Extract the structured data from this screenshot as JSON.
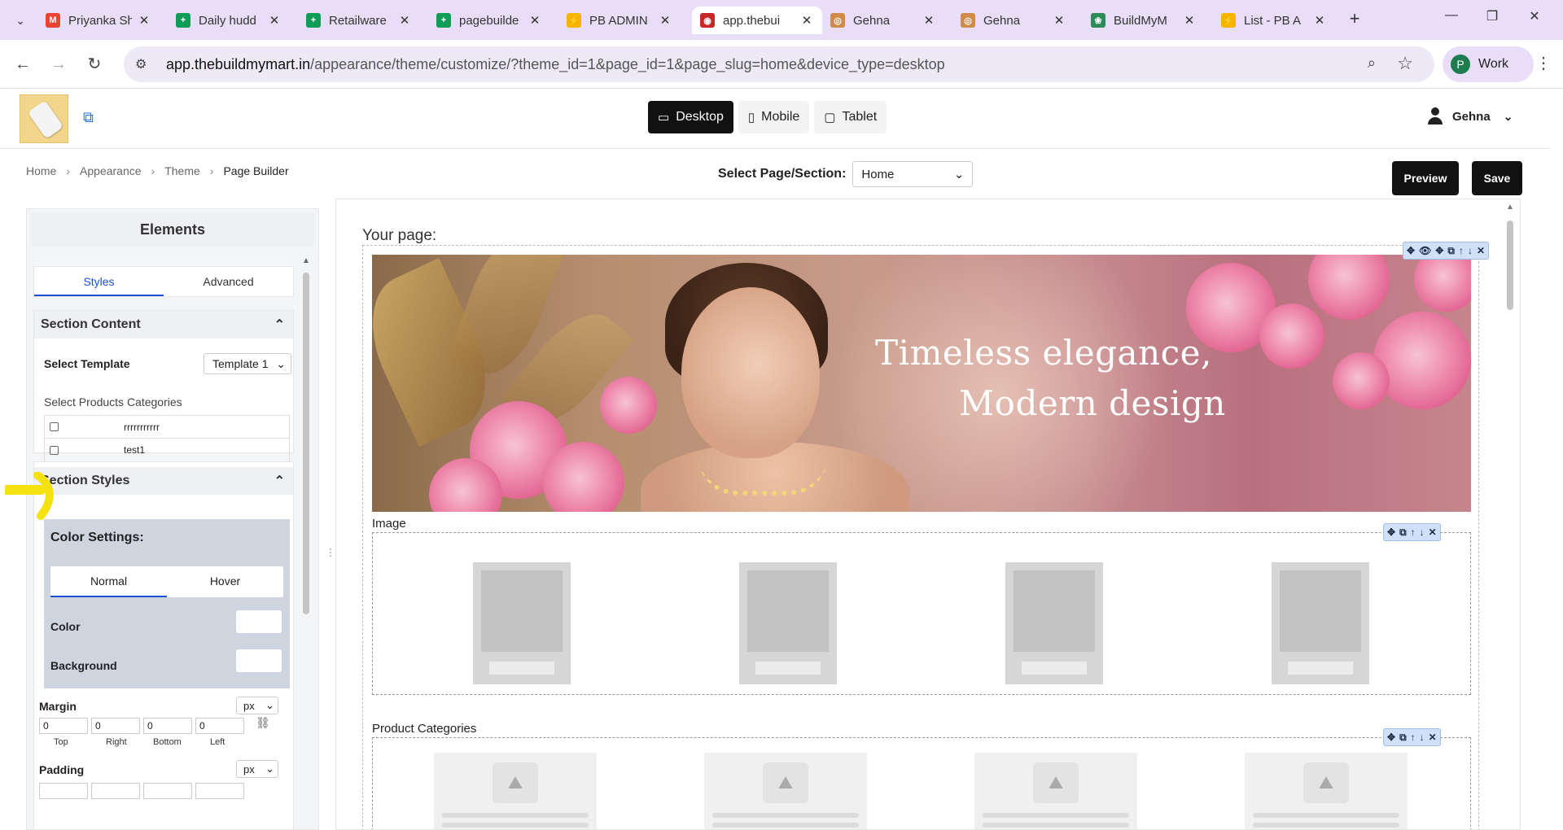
{
  "browser": {
    "tabs": [
      {
        "title": "Priyanka Sh",
        "fav": "M",
        "color": "#ea4335"
      },
      {
        "title": "Daily hudd",
        "fav": "+",
        "color": "#0f9d58"
      },
      {
        "title": "Retailware",
        "fav": "+",
        "color": "#0f9d58"
      },
      {
        "title": "pagebuilde",
        "fav": "+",
        "color": "#0f9d58"
      },
      {
        "title": "PB ADMIN",
        "fav": "⚡",
        "color": "#f4b400"
      },
      {
        "title": "app.thebui",
        "fav": "◉",
        "color": "#c62828"
      },
      {
        "title": "Gehna",
        "fav": "◎",
        "color": "#d08a4a"
      },
      {
        "title": "Gehna",
        "fav": "◎",
        "color": "#d08a4a"
      },
      {
        "title": "BuildMyM",
        "fav": "❀",
        "color": "#2e8b57"
      },
      {
        "title": "List - PB A",
        "fav": "⚡",
        "color": "#f4b400"
      }
    ],
    "url_host": "app.thebuildmymart.in",
    "url_path": "/appearance/theme/customize/?theme_id=1&page_id=1&page_slug=home&device_type=desktop",
    "profile_initial": "P",
    "profile_label": "Work"
  },
  "header": {
    "devices": [
      "Desktop",
      "Mobile",
      "Tablet"
    ],
    "active_device": "Desktop",
    "user_name": "Gehna"
  },
  "breadcrumb": [
    "Home",
    "Appearance",
    "Theme",
    "Page Builder"
  ],
  "page_select": {
    "label": "Select Page/Section:",
    "value": "Home"
  },
  "actions": {
    "preview": "Preview",
    "save": "Save"
  },
  "panel": {
    "title": "Elements",
    "tabs": [
      "Styles",
      "Advanced"
    ],
    "section_content": {
      "heading": "Section Content",
      "template_label": "Select Template",
      "template_value": "Template 1",
      "categories_label": "Select Products Categories",
      "categories": [
        "rrrrrrrrrrr",
        "test1"
      ]
    },
    "section_styles": {
      "heading": "Section Styles",
      "color_settings": "Color Settings:",
      "state_tabs": [
        "Normal",
        "Hover"
      ],
      "color_label": "Color",
      "background_label": "Background",
      "margin_label": "Margin",
      "margin_unit": "px",
      "margin_values": [
        "0",
        "0",
        "0",
        "0"
      ],
      "sides": [
        "Top",
        "Right",
        "Bottom",
        "Left"
      ],
      "padding_label": "Padding",
      "padding_unit": "px"
    }
  },
  "canvas": {
    "heading": "Your page:",
    "banner_text_line1": "Timeless elegance,",
    "banner_text_line2": "Modern design",
    "image_label": "Image",
    "product_categories_label": "Product Categories"
  }
}
